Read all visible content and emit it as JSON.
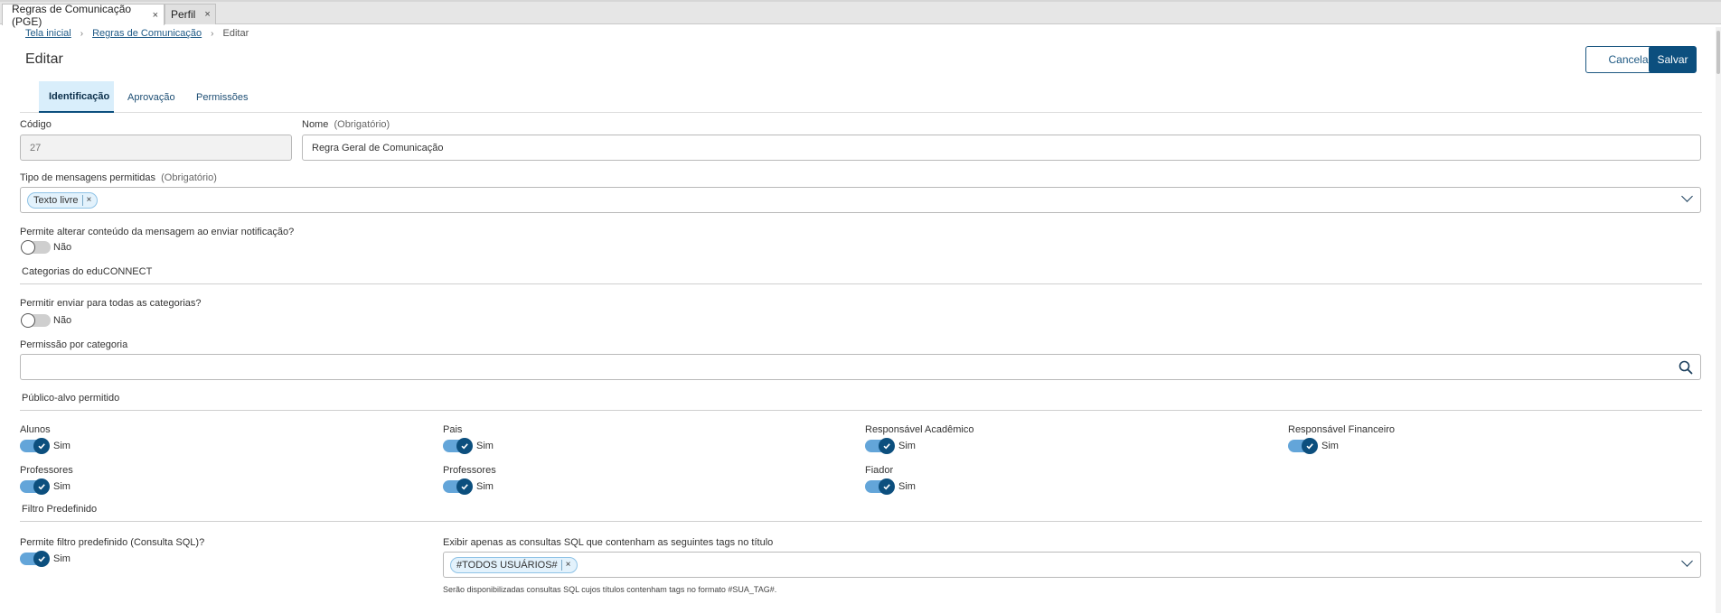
{
  "window_tabs": [
    {
      "label": "Regras de Comunicação (PGE)",
      "close": "×"
    },
    {
      "label": "Perfil",
      "close": "×"
    }
  ],
  "breadcrumb": {
    "home": "Tela inicial",
    "parent": "Regras de Comunicação",
    "current": "Editar"
  },
  "page_title": "Editar",
  "actions": {
    "cancel": "Cancelar",
    "save": "Salvar"
  },
  "tabs": [
    "Identificação",
    "Aprovação",
    "Permissões"
  ],
  "form": {
    "codigo_label": "Código",
    "codigo_value": "27",
    "nome_label": "Nome",
    "nome_required": "(Obrigatório)",
    "nome_value": "Regra Geral de Comunicação",
    "tipo_label": "Tipo de mensagens permitidas",
    "tipo_required": "(Obrigatório)",
    "tipo_chip": "Texto livre",
    "chip_close": "×",
    "alterar_label": "Permite alterar conteúdo da mensagem ao enviar notificação?",
    "alterar_value": "Não",
    "section_categorias": "Categorias do eduCONNECT",
    "todas_label": "Permitir enviar para todas as categorias?",
    "todas_value": "Não",
    "permissao_label": "Permissão por categoria",
    "permissao_value": "",
    "section_publico": "Público-alvo permitido",
    "publico": [
      {
        "label": "Alunos",
        "value": "Sim"
      },
      {
        "label": "Pais",
        "value": "Sim"
      },
      {
        "label": "Responsável Acadêmico",
        "value": "Sim"
      },
      {
        "label": "Responsável Financeiro",
        "value": "Sim"
      },
      {
        "label": "Professores",
        "value": "Sim"
      },
      {
        "label": "Professores",
        "value": "Sim"
      },
      {
        "label": "Fiador",
        "value": "Sim"
      }
    ],
    "section_filtro": "Filtro Predefinido",
    "filtro_label": "Permite filtro predefinido (Consulta SQL)?",
    "filtro_value": "Sim",
    "tags_label": "Exibir apenas as consultas SQL que contenham as seguintes tags no título",
    "tags_chip": "#TODOS USUÁRIOS#",
    "tags_hint": "Serão disponibilizadas consultas SQL cujos títulos contenham tags no formato #SUA_TAG#."
  },
  "icons": {
    "search": "search-icon",
    "chevron": "chevron-down-icon",
    "check": "check-icon"
  },
  "colors": {
    "primary": "#0c4f7e",
    "toggle_track_on": "#63a5d9",
    "tab_active_bg": "#d9eefb",
    "chip_bg": "#e3f2fc"
  }
}
